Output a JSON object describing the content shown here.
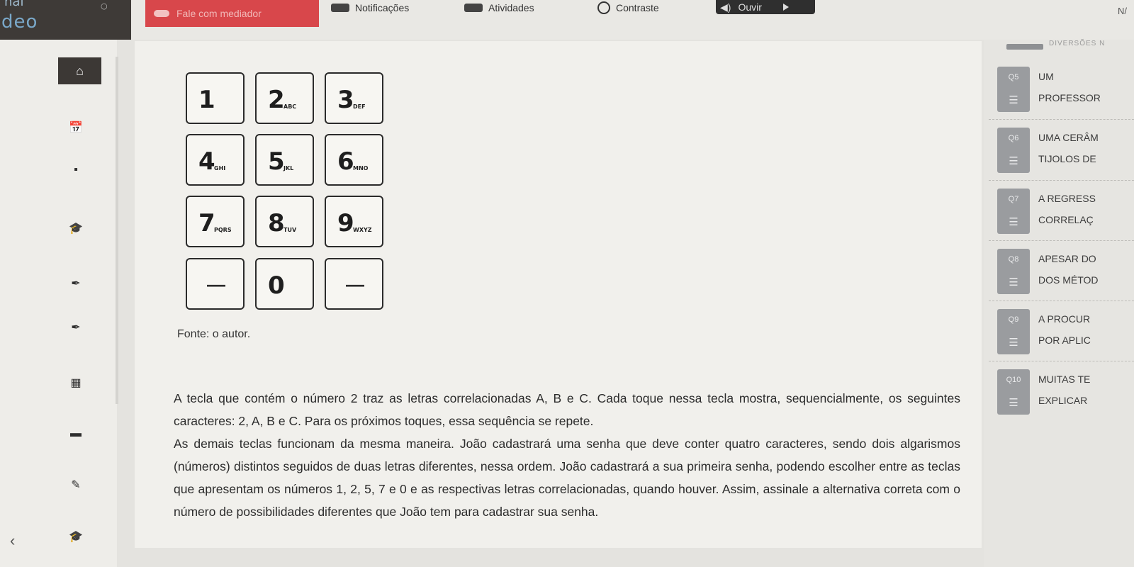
{
  "topbar": {
    "brand_top": "nai",
    "brand": "deo",
    "chat_label": "Fale com mediador",
    "notif_label": "Notificações",
    "ativ_label": "Atividades",
    "contraste_label": "Contraste",
    "ouvir_label": "Ouvir",
    "corner": "N/"
  },
  "keypad": {
    "keys": [
      {
        "digit": "1",
        "letters": ""
      },
      {
        "digit": "2",
        "letters": "ABC"
      },
      {
        "digit": "3",
        "letters": "DEF"
      },
      {
        "digit": "4",
        "letters": "GHI"
      },
      {
        "digit": "5",
        "letters": "JKL"
      },
      {
        "digit": "6",
        "letters": "MNO"
      },
      {
        "digit": "7",
        "letters": "PQRS"
      },
      {
        "digit": "8",
        "letters": "TUV"
      },
      {
        "digit": "9",
        "letters": "WXYZ"
      },
      {
        "digit": "",
        "letters": "",
        "dash": "—"
      },
      {
        "digit": "0",
        "letters": ""
      },
      {
        "digit": "",
        "letters": "",
        "dash": "—"
      }
    ]
  },
  "content": {
    "fonte": "Fonte: o autor.",
    "paragraph1": "A tecla que contém o número 2 traz as letras correlacionadas A, B e C. Cada toque nessa tecla mostra, sequencialmente, os seguintes caracteres: 2, A, B e C. Para os próximos toques, essa sequência se repete.",
    "paragraph2": "As demais teclas funcionam da mesma maneira. João cadastrará uma senha que deve conter quatro caracteres, sendo dois algarismos (números) distintos seguidos de duas letras diferentes, nessa ordem. João cadastrará a sua primeira senha, podendo escolher entre as teclas que apresentam os números 1, 2, 5, 7 e 0 e as respectivas letras correlacionadas, quando houver. Assim, assinale a alternativa correta com o número de possibilidades diferentes que João tem para cadastrar sua senha."
  },
  "right_panel": {
    "header": "DIVERSÕES N",
    "questions": [
      {
        "num": "Q5",
        "line1": "UM",
        "line2": "PROFESSOR"
      },
      {
        "num": "Q6",
        "line1": "UMA CERÂM",
        "line2": "TIJOLOS DE"
      },
      {
        "num": "Q7",
        "line1": "A REGRESS",
        "line2": "CORRELAÇ"
      },
      {
        "num": "Q8",
        "line1": "APESAR DO",
        "line2": "DOS MÉTOD"
      },
      {
        "num": "Q9",
        "line1": "A PROCUR",
        "line2": "POR APLIC"
      },
      {
        "num": "Q10",
        "line1": "MUITAS TE",
        "line2": "EXPLICAR"
      }
    ]
  },
  "left_rail": {
    "icons": [
      "home-icon",
      "calendar-check-icon",
      "tag-icon",
      "graduation-cap-icon",
      "pen-icon",
      "pen-icon",
      "calendar-icon",
      "briefcase-icon",
      "pencil-icon",
      "graduation-cap-icon"
    ],
    "back": "‹"
  }
}
